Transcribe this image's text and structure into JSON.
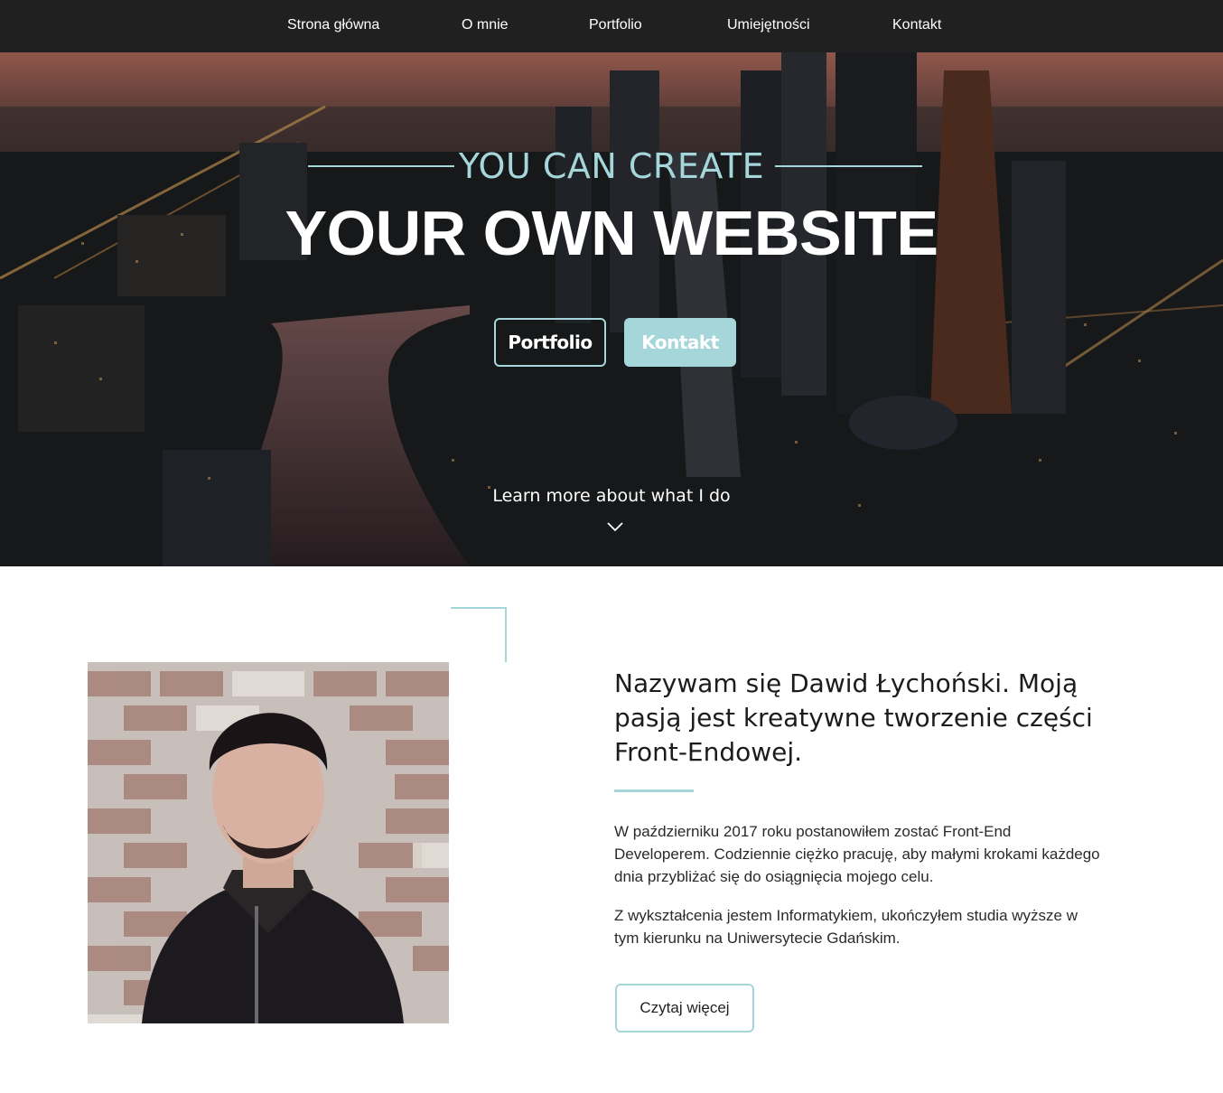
{
  "nav": {
    "items": [
      {
        "label": "Strona główna"
      },
      {
        "label": "O mnie"
      },
      {
        "label": "Portfolio"
      },
      {
        "label": "Umiejętności"
      },
      {
        "label": "Kontakt"
      }
    ]
  },
  "hero": {
    "kicker": "YOU CAN CREATE",
    "title": "YOUR OWN WEBSITE",
    "buttons": {
      "portfolio_label": "Portfolio",
      "contact_label": "Kontakt"
    },
    "learn_more": "Learn more about what I do",
    "background_image": "night city skyline with river and skyscrapers"
  },
  "about": {
    "photo_alt": "portrait photo in front of a brick wall",
    "heading": "Nazywam się Dawid Łychoński. Moją pasją jest kreatywne tworzenie części Front-Endowej.",
    "paragraphs": [
      "W październiku 2017 roku postanowiłem zostać Front-End Developerem. Codziennie ciężko pracuję, aby małymi krokami każdego dnia przybliżać się do osiągnięcia mojego celu.",
      "Z wykształcenia jestem Informatykiem, ukończyłem studia wyższe w tym kierunku na Uniwersytecie Gdańskim."
    ],
    "read_more_label": "Czytaj więcej"
  },
  "colors": {
    "accent": "#a5d6d9",
    "nav_bg": "#202020"
  }
}
